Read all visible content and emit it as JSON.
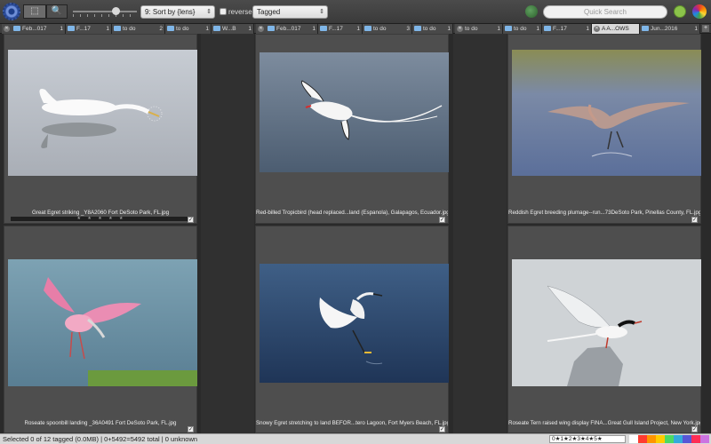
{
  "toolbar": {
    "select_tool": "⬚",
    "zoom_tool": "🔍",
    "sort_label": "9: Sort by {lens}",
    "reverse_label": "reverse",
    "tag_filter": "Tagged",
    "search_placeholder": "Quick Search"
  },
  "tabs": [
    {
      "label": "Feb...017",
      "count": "1"
    },
    {
      "label": "F...17",
      "count": "1"
    },
    {
      "label": "to do",
      "count": "2"
    },
    {
      "label": "to do",
      "count": "1"
    },
    {
      "label": "W...B",
      "count": "1"
    },
    {
      "label": "Feb...017",
      "count": "1"
    },
    {
      "label": "F...17",
      "count": "1"
    },
    {
      "label": "to do",
      "count": "3"
    },
    {
      "label": "to do",
      "count": "1"
    },
    {
      "label": "to do",
      "count": "1"
    },
    {
      "label": "to do",
      "count": "1"
    },
    {
      "label": "F...17",
      "count": "1"
    },
    {
      "label": "A A...OWS",
      "count": ""
    },
    {
      "label": "Jun...2016",
      "count": "1"
    }
  ],
  "photos": [
    {
      "caption": "Great Egret striking _Y8A2060 Fort DeSoto Park, FL.jpg",
      "icon": "egret-photo",
      "stars": "★ ★ ★ ★ ★"
    },
    {
      "caption": "Red-billed Tropicbird (head replaced...land (Espanola), Galapagos, Ecuador.jpg",
      "icon": "tropicbird-photo"
    },
    {
      "caption": "Reddish Egret breeding plumage--run...73DeSoto Park, Pinellas County, FL.jpg",
      "icon": "reddish-egret-photo"
    },
    {
      "caption": "Roseate spoonbill landing _36A0491 Fort DeSoto Park, FL.jpg",
      "icon": "spoonbill-photo"
    },
    {
      "caption": "Snowy Egret stretching to land BEFOR...tero Lagoon, Fort Myers Beach, FL.jpg",
      "icon": "snowy-egret-photo"
    },
    {
      "caption": "Roseate Tern raised wing display FINA...Great Gull Island Project, New York.jpg",
      "icon": "tern-photo"
    }
  ],
  "status": {
    "text": "Selected 0 of 12 tagged (0.0MB) | 0+5492=5492 total | 0 unknown",
    "rating_filter": "0★1★2★3★4★5★"
  },
  "colors": {
    "accent": "#7fb6e8",
    "label_colors": [
      "#ffffff",
      "#ff3b30",
      "#ff9500",
      "#ffcc00",
      "#4cd964",
      "#34aadc",
      "#5856d6",
      "#ff2d55",
      "#cc73e1"
    ]
  }
}
